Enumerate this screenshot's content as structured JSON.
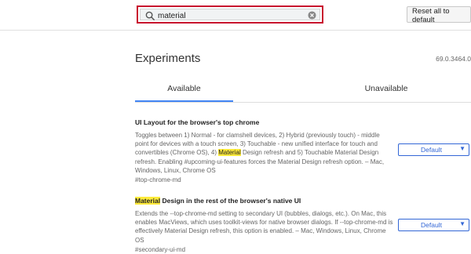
{
  "search": {
    "value": "material"
  },
  "toolbar": {
    "reset_label": "Reset all to default"
  },
  "header": {
    "title": "Experiments",
    "version": "69.0.3464.0"
  },
  "tabs": [
    {
      "label": "Available",
      "active": true
    },
    {
      "label": "Unavailable",
      "active": false
    }
  ],
  "experiments": [
    {
      "title": "UI Layout for the browser's top chrome",
      "desc_pre": "Toggles between 1) Normal - for clamshell devices, 2) Hybrid (previously touch) - middle point for devices with a touch screen, 3) Touchable - new unified interface for touch and convertibles (Chrome OS), 4) ",
      "desc_highlight": "Material",
      "desc_post": " Design refresh and 5) Touchable Material Design refresh. Enabling #upcoming-ui-features forces the Material Design refresh option. – Mac, Windows, Linux, Chrome OS",
      "link": "#top-chrome-md",
      "select_value": "Default"
    },
    {
      "title_highlight": "Material",
      "title_rest": " Design in the rest of the browser's native UI",
      "desc": "Extends the --top-chrome-md setting to secondary UI (bubbles, dialogs, etc.). On Mac, this enables MacViews, which uses toolkit-views for native browser dialogs. If --top-chrome-md is effectively Material Design refresh, this option is enabled. – Mac, Windows, Linux, Chrome OS",
      "link": "#secondary-ui-md",
      "select_value": "Default"
    }
  ],
  "colors": {
    "accent": "#4285f4",
    "highlight": "#ffeb3b",
    "search_border": "#c8102e"
  }
}
